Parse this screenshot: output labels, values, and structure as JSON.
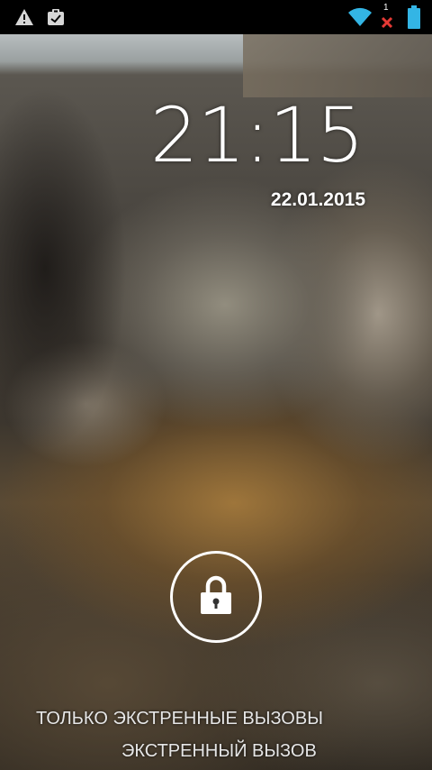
{
  "status_bar": {
    "left_icons": [
      "warning-icon",
      "clipboard-check-icon"
    ],
    "right_icons": [
      "wifi-icon",
      "no-signal-icon",
      "battery-icon"
    ],
    "network_count": "1",
    "colors": {
      "wifi": "#33b5e5",
      "no_signal": "#e53935",
      "battery": "#33b5e5"
    }
  },
  "lockscreen": {
    "time": "21:15",
    "date": "22.01.2015",
    "unlock_icon": "lock-icon",
    "emergency_only_text": "ТОЛЬКО ЭКСТРЕННЫЕ ВЫЗОВЫ",
    "emergency_call_label": "ЭКСТРЕННЫЙ ВЫЗОВ"
  }
}
